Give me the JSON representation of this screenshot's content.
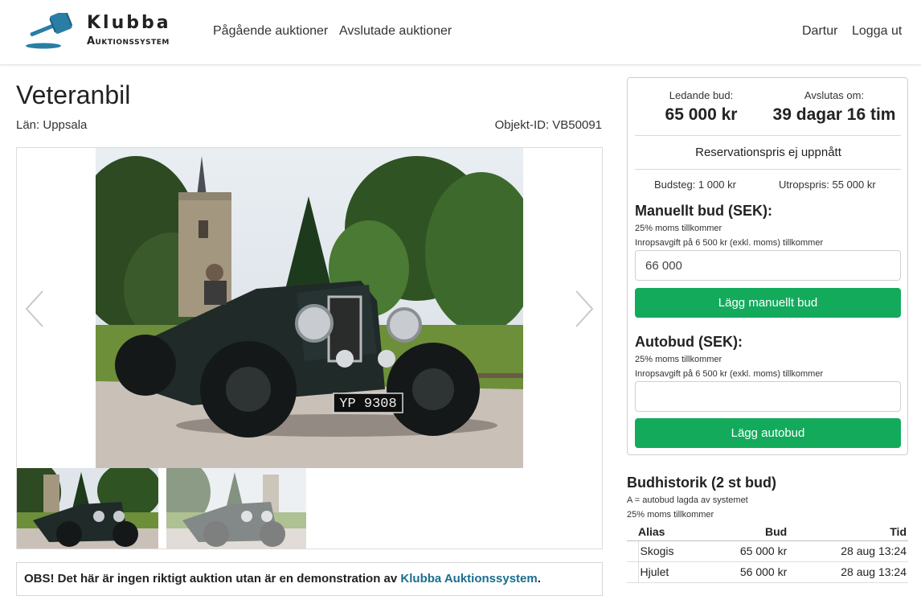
{
  "brand": {
    "name": "Klubba",
    "subtitle": "Auktionssystem"
  },
  "nav": {
    "ongoing": "Pågående auktioner",
    "ended": "Avslutade auktioner",
    "user": "Dartur",
    "logout": "Logga ut"
  },
  "item": {
    "title": "Veteranbil",
    "county": "Län: Uppsala",
    "object_id": "Objekt-ID: VB50091",
    "plate": "YP 9308"
  },
  "gallery": {
    "photo_count": 2,
    "active_index": 0
  },
  "bid_panel": {
    "leading_label": "Ledande bud:",
    "leading_value": "65 000 kr",
    "ends_label": "Avslutas om:",
    "ends_value": "39 dagar 16 tim",
    "reserve": "Reservationspris ej uppnått",
    "bid_step": "Budsteg: 1 000 kr",
    "start_price": "Utropspris: 55 000 kr",
    "manual": {
      "heading": "Manuellt bud (SEK):",
      "vat": "25% moms tillkommer",
      "fee": "Inropsavgift på 6 500 kr (exkl. moms) tillkommer",
      "value": "66 000",
      "button": "Lägg manuellt bud"
    },
    "auto": {
      "heading": "Autobud (SEK):",
      "vat": "25% moms tillkommer",
      "fee": "Inropsavgift på 6 500 kr (exkl. moms) tillkommer",
      "value": "",
      "button": "Lägg autobud"
    }
  },
  "history": {
    "title": "Budhistorik (2 st bud)",
    "note_auto": "A = autobud lagda av systemet",
    "note_vat": "25% moms tillkommer",
    "columns": {
      "alias": "Alias",
      "bid": "Bud",
      "time": "Tid"
    },
    "rows": [
      {
        "alias": "Skogis",
        "bid": "65 000 kr",
        "time": "28 aug 13:24"
      },
      {
        "alias": "Hjulet",
        "bid": "56 000 kr",
        "time": "28 aug 13:24"
      }
    ]
  },
  "notice": {
    "prefix": "OBS! Det här är ingen riktigt auktion utan är en demonstration av ",
    "link": "Klubba Auktionssystem",
    "suffix": "."
  },
  "colors": {
    "accent_green": "#13aa5c",
    "link_blue": "#1c6d8f",
    "logo_blue": "#2a7ea5"
  }
}
